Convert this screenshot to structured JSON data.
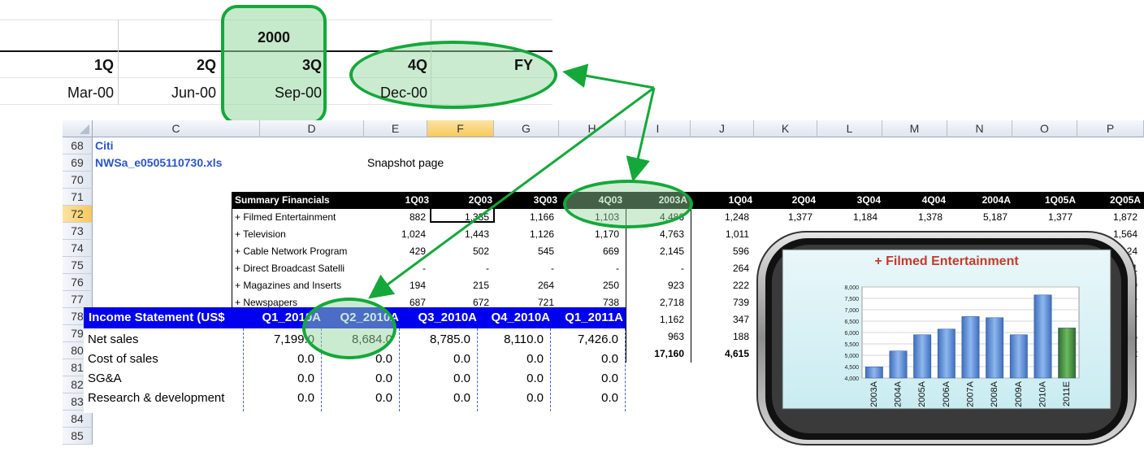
{
  "top_panel": {
    "year": "2000",
    "quarters": [
      "1Q",
      "2Q",
      "3Q",
      "4Q",
      "FY"
    ],
    "dates": [
      "Mar-00",
      "Jun-00",
      "Sep-00",
      "Dec-00",
      ""
    ]
  },
  "sheet": {
    "columns": [
      "C",
      "D",
      "E",
      "F",
      "G",
      "H",
      "I",
      "J",
      "K",
      "L",
      "M",
      "N",
      "O",
      "P"
    ],
    "selected_column": "F",
    "rows": [
      "68",
      "69",
      "70",
      "71",
      "72",
      "73",
      "74",
      "75",
      "76",
      "77",
      "78",
      "79",
      "80",
      "81",
      "82",
      "83",
      "84",
      "85"
    ],
    "selected_row": "72",
    "cells": {
      "citi": "Citi",
      "file": "NWSa_e0505110730.xls",
      "snapshot": "Snapshot page"
    }
  },
  "summary_financials": {
    "title": "Summary Financials",
    "headers": [
      "1Q03",
      "2Q03",
      "3Q03",
      "4Q03",
      "2003A",
      "1Q04",
      "2Q04",
      "3Q04",
      "4Q04",
      "2004A",
      "1Q05A",
      "2Q05A"
    ],
    "rows": [
      {
        "label": "+ Filmed Entertainment",
        "values": [
          "882",
          "1,335",
          "1,166",
          "1,103",
          "4,486",
          "1,248",
          "1,377",
          "1,184",
          "1,378",
          "5,187",
          "1,377",
          "1,872"
        ]
      },
      {
        "label": "+ Television",
        "values": [
          "1,024",
          "1,443",
          "1,126",
          "1,170",
          "4,763",
          "1,011",
          "",
          "",
          "",
          "",
          "",
          "1,564"
        ]
      },
      {
        "label": "+ Cable Network Program",
        "values": [
          "429",
          "502",
          "545",
          "669",
          "2,145",
          "596",
          "",
          "",
          "",
          "",
          "",
          "24"
        ]
      },
      {
        "label": "+ Direct Broadcast Satelli",
        "values": [
          "-",
          "-",
          "-",
          "-",
          "-",
          "264",
          "",
          "",
          "",
          "",
          "",
          "1"
        ]
      },
      {
        "label": "+ Magazines and Inserts",
        "values": [
          "194",
          "215",
          "264",
          "250",
          "923",
          "222",
          "",
          "",
          "",
          "",
          "",
          "9"
        ]
      },
      {
        "label": "+ Newspapers",
        "values": [
          "687",
          "672",
          "721",
          "738",
          "2,718",
          "739",
          "",
          "",
          "",
          "",
          "",
          "7"
        ]
      },
      {
        "label": "",
        "values": [
          "",
          "",
          "",
          "",
          "1,162",
          "347",
          "",
          "",
          "",
          "",
          "",
          "7"
        ]
      },
      {
        "label": "",
        "values": [
          "",
          "",
          "",
          "",
          "963",
          "188",
          "",
          "",
          "",
          "",
          "",
          "5"
        ]
      },
      {
        "label": "",
        "values": [
          "",
          "",
          "",
          "",
          "17,160",
          "4,615",
          "",
          "",
          "",
          "",
          "",
          "2"
        ]
      }
    ]
  },
  "income_statement": {
    "title": "Income Statement (US$",
    "headers": [
      "Q1_2010A",
      "Q2_2010A",
      "Q3_2010A",
      "Q4_2010A",
      "Q1_2011A"
    ],
    "rows": [
      {
        "label": "Net sales",
        "values": [
          "7,199.0",
          "8,684.0",
          "8,785.0",
          "8,110.0",
          "7,426.0"
        ]
      },
      {
        "label": "Cost of sales",
        "values": [
          "0.0",
          "0.0",
          "0.0",
          "0.0",
          "0.0"
        ]
      },
      {
        "label": "SG&A",
        "values": [
          "0.0",
          "0.0",
          "0.0",
          "0.0",
          "0.0"
        ]
      },
      {
        "label": "Research & development",
        "values": [
          "0.0",
          "0.0",
          "0.0",
          "0.0",
          "0.0"
        ]
      }
    ]
  },
  "chart_data": {
    "type": "bar",
    "title": "+ Filmed Entertainment",
    "categories": [
      "2003A",
      "2004A",
      "2005A",
      "2006A",
      "2007A",
      "2008A",
      "2009A",
      "2010A",
      "2011E"
    ],
    "values": [
      4486,
      5187,
      5900,
      6150,
      6700,
      6650,
      5900,
      7650,
      6200
    ],
    "yticks": [
      "8,000",
      "7,500",
      "7,000",
      "6,500",
      "6,000",
      "5,500",
      "5,000",
      "4,500",
      "4,000"
    ],
    "ylim": [
      4000,
      8000
    ],
    "bar_color": "#5b8fd6",
    "highlight_color": "#3f8f3a",
    "highlight_index": 8,
    "grid": true
  },
  "colors": {
    "highlight_green": "#14a83a",
    "income_header_blue": "#0000ee"
  }
}
